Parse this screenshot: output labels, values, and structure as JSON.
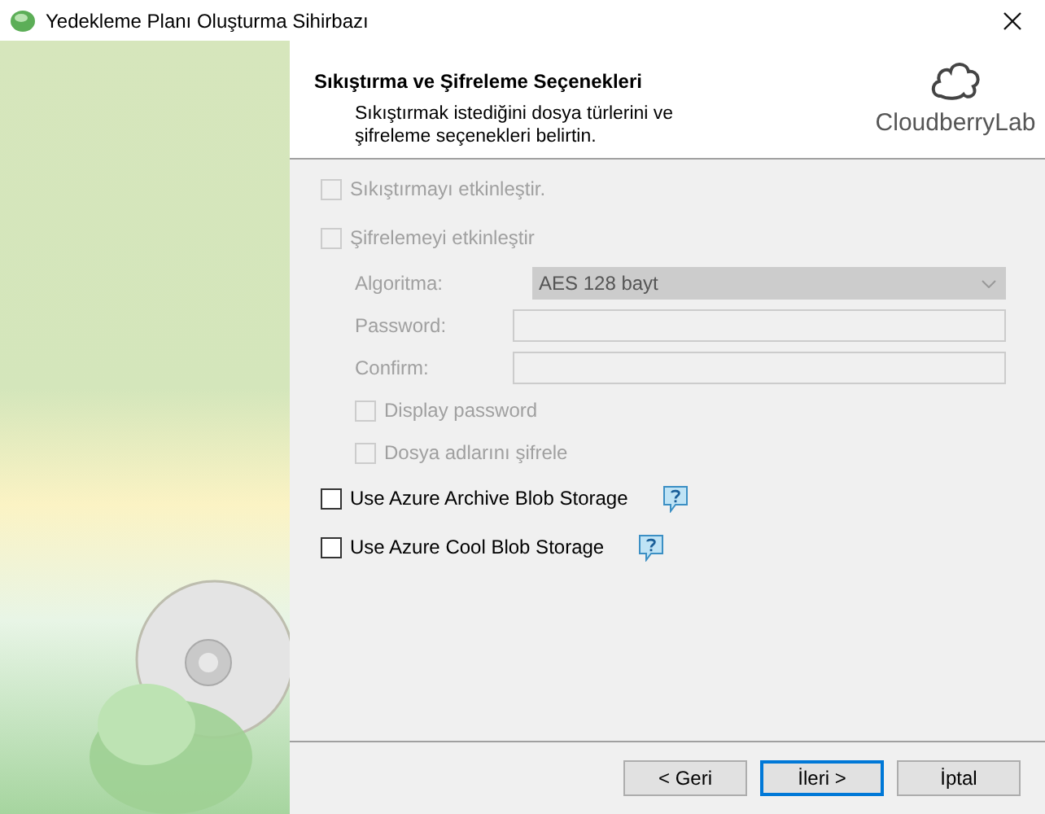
{
  "window": {
    "title": "Yedekleme Planı Oluşturma Sihirbazı"
  },
  "header": {
    "title": "Sıkıştırma ve Şifreleme Seçenekleri",
    "subtitle": "Sıkıştırmak istediğini dosya türlerini ve şifreleme seçenekleri belirtin.",
    "logo_text": "CloudberryLab"
  },
  "compression": {
    "label": "Sıkıştırmayı etkinleştir.",
    "checked": false,
    "disabled": true
  },
  "encryption": {
    "label": "Şifrelemeyi etkinleştir",
    "checked": false,
    "disabled": true,
    "children": [
      {
        "kind": "select",
        "label": "Algoritma:",
        "value": "AES 128 bayt",
        "disabled": true
      },
      {
        "kind": "text",
        "label": "Password:",
        "disabled": true
      },
      {
        "kind": "text",
        "label": "Confirm:",
        "disabled": true
      },
      {
        "kind": "checkbox",
        "label": "Display password",
        "checked": false,
        "disabled": true
      },
      {
        "kind": "checkbox",
        "label": "Dosya adlarını şifrele",
        "checked": false,
        "disabled": true
      }
    ]
  },
  "azure_options": [
    {
      "label": "Use Azure Archive Blob Storage",
      "checked": false,
      "disabled": false
    },
    {
      "label": "Use Azure Cool Blob Storage",
      "checked": false,
      "disabled": false
    }
  ],
  "buttons": [
    {
      "label": "< Geri",
      "selected": false
    },
    {
      "label": "İleri >",
      "selected": true
    },
    {
      "label": "İptal",
      "selected": false
    }
  ]
}
